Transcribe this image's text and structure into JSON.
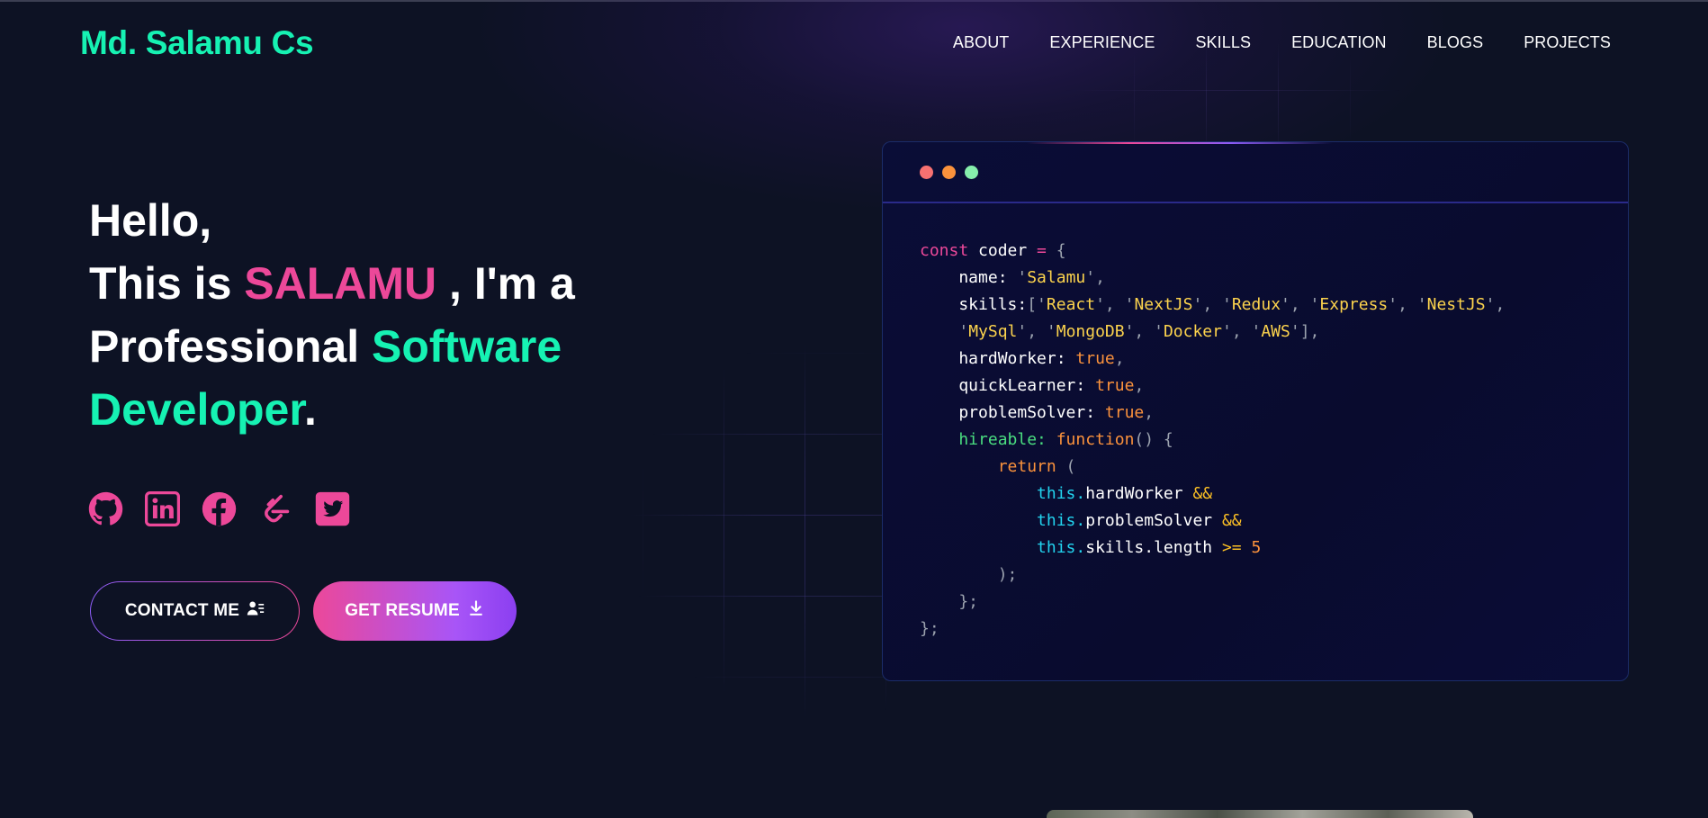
{
  "brand": {
    "name": "Md. Salamu Cs",
    "color": "#16f2b3"
  },
  "nav": {
    "items": [
      "ABOUT",
      "EXPERIENCE",
      "SKILLS",
      "EDUCATION",
      "BLOGS",
      "PROJECTS"
    ]
  },
  "hero": {
    "line1": "Hello,",
    "line2_prefix": "This is ",
    "name": "SALAMU",
    "line2_suffix": " , I'm a",
    "line3_prefix": "Professional ",
    "role_word1": "Software",
    "role_word2": "Developer",
    "period": "."
  },
  "socials": [
    {
      "icon": "github-icon"
    },
    {
      "icon": "linkedin-icon"
    },
    {
      "icon": "facebook-icon"
    },
    {
      "icon": "leetcode-icon"
    },
    {
      "icon": "twitter-icon"
    }
  ],
  "buttons": {
    "contact_label": "CONTACT ME",
    "contact_icon": "user-contact-icon",
    "resume_label": "GET RESUME",
    "resume_icon": "download-icon"
  },
  "code_window": {
    "dots": [
      "#f87171",
      "#fb923c",
      "#86efac"
    ],
    "lines": [
      [
        {
          "c": "k",
          "t": "const"
        },
        {
          "c": "",
          "t": " coder "
        },
        {
          "c": "o",
          "t": "="
        },
        {
          "c": "p",
          "t": " {"
        }
      ],
      [
        {
          "c": "",
          "t": "    name: "
        },
        {
          "c": "p",
          "t": "'"
        },
        {
          "c": "s",
          "t": "Salamu"
        },
        {
          "c": "p",
          "t": "',"
        }
      ],
      [
        {
          "c": "",
          "t": "    skills:"
        },
        {
          "c": "p",
          "t": "['"
        },
        {
          "c": "s",
          "t": "React"
        },
        {
          "c": "p",
          "t": "', '"
        },
        {
          "c": "s",
          "t": "NextJS"
        },
        {
          "c": "p",
          "t": "', '"
        },
        {
          "c": "s",
          "t": "Redux"
        },
        {
          "c": "p",
          "t": "', '"
        },
        {
          "c": "s",
          "t": "Express"
        },
        {
          "c": "p",
          "t": "', '"
        },
        {
          "c": "s",
          "t": "NestJS"
        },
        {
          "c": "p",
          "t": "',"
        }
      ],
      [
        {
          "c": "p",
          "t": "    '"
        },
        {
          "c": "s",
          "t": "MySql"
        },
        {
          "c": "p",
          "t": "', '"
        },
        {
          "c": "s",
          "t": "MongoDB"
        },
        {
          "c": "p",
          "t": "', '"
        },
        {
          "c": "s",
          "t": "Docker"
        },
        {
          "c": "p",
          "t": "', '"
        },
        {
          "c": "s",
          "t": "AWS"
        },
        {
          "c": "p",
          "t": "'],"
        }
      ],
      [
        {
          "c": "",
          "t": "    hardWorker: "
        },
        {
          "c": "t",
          "t": "true"
        },
        {
          "c": "p",
          "t": ","
        }
      ],
      [
        {
          "c": "",
          "t": "    quickLearner: "
        },
        {
          "c": "t",
          "t": "true"
        },
        {
          "c": "p",
          "t": ","
        }
      ],
      [
        {
          "c": "",
          "t": "    problemSolver: "
        },
        {
          "c": "t",
          "t": "true"
        },
        {
          "c": "p",
          "t": ","
        }
      ],
      [
        {
          "c": "f",
          "t": "    hireable: "
        },
        {
          "c": "t",
          "t": "function"
        },
        {
          "c": "p",
          "t": "() {"
        }
      ],
      [
        {
          "c": "t",
          "t": "        return"
        },
        {
          "c": "p",
          "t": " ("
        }
      ],
      [
        {
          "c": "c",
          "t": "            this."
        },
        {
          "c": "",
          "t": "hardWorker "
        },
        {
          "c": "y",
          "t": "&&"
        }
      ],
      [
        {
          "c": "c",
          "t": "            this."
        },
        {
          "c": "",
          "t": "problemSolver "
        },
        {
          "c": "y",
          "t": "&&"
        }
      ],
      [
        {
          "c": "c",
          "t": "            this."
        },
        {
          "c": "",
          "t": "skills.length "
        },
        {
          "c": "y",
          "t": ">="
        },
        {
          "c": "t",
          "t": " 5"
        }
      ],
      [
        {
          "c": "p",
          "t": "        );"
        }
      ],
      [
        {
          "c": "p",
          "t": "    };"
        }
      ],
      [
        {
          "c": "p",
          "t": "};"
        }
      ]
    ]
  }
}
